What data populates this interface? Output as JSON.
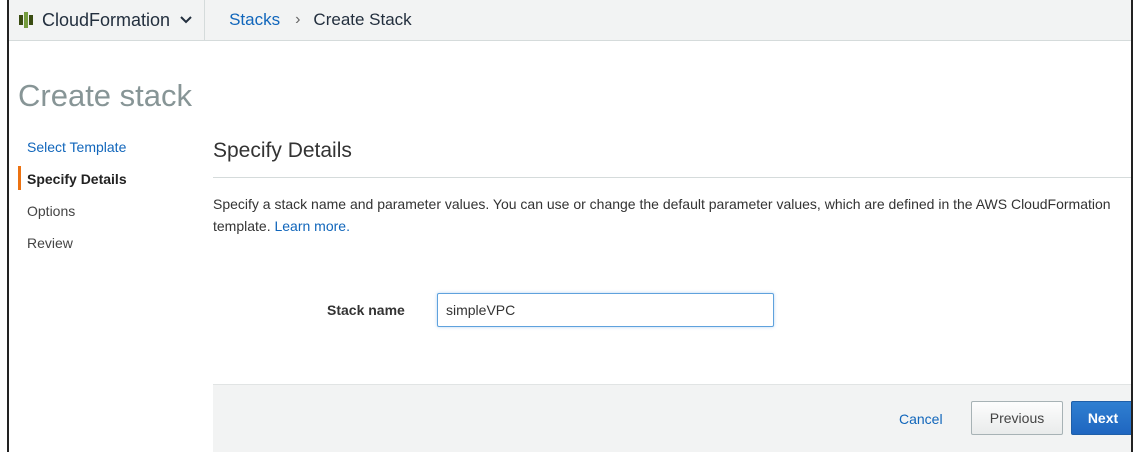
{
  "colors": {
    "link": "#1166bb",
    "accent_active_step": "#ec7211",
    "title_gray": "#879596",
    "primary_button": "#1f66c0"
  },
  "topbar": {
    "service_icon": "cloudformation-icon",
    "service_name": "CloudFormation",
    "service_dropdown_icon": "chevron-down-icon",
    "breadcrumb": {
      "link": "Stacks",
      "separator": "›",
      "current": "Create Stack"
    }
  },
  "page": {
    "title": "Create stack"
  },
  "steps": [
    {
      "label": "Select Template",
      "state": "link"
    },
    {
      "label": "Specify Details",
      "state": "active"
    },
    {
      "label": "Options",
      "state": "plain"
    },
    {
      "label": "Review",
      "state": "plain"
    }
  ],
  "section": {
    "title": "Specify Details",
    "description": "Specify a stack name and parameter values. You can use or change the default parameter values, which are defined in the AWS CloudFormation template.",
    "learn_more": "Learn more."
  },
  "form": {
    "stack_name_label": "Stack name",
    "stack_name_value": "simpleVPC"
  },
  "footer": {
    "cancel_label": "Cancel",
    "previous_label": "Previous",
    "next_label": "Next"
  }
}
